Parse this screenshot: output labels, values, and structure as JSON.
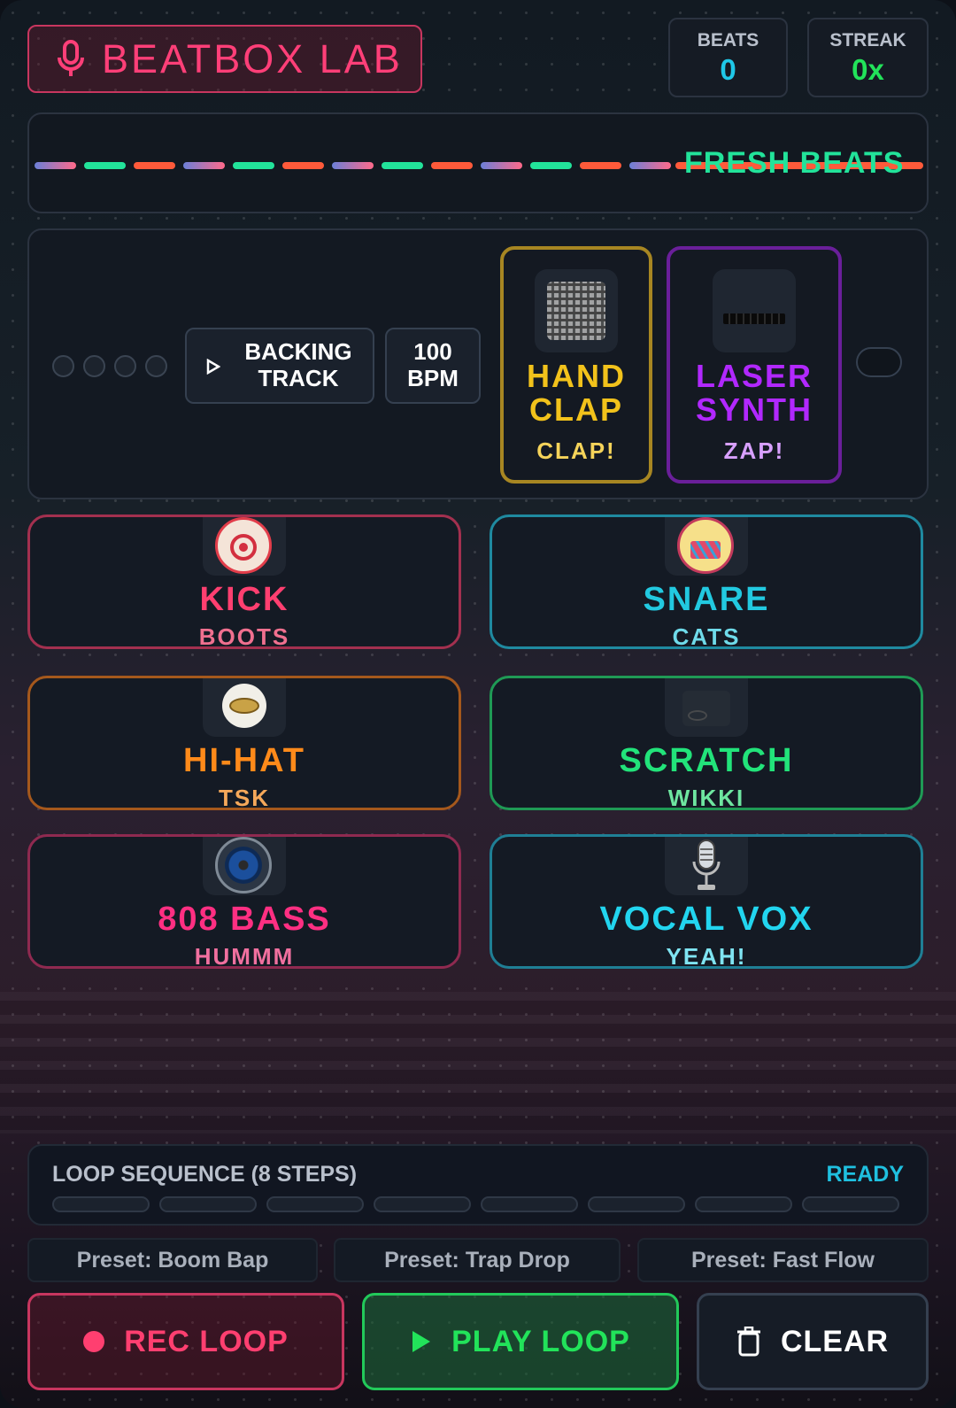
{
  "header": {
    "title": "BEATBOX LAB",
    "stats": [
      {
        "label": "BEATS",
        "value": "0",
        "color": "#1fc8e8"
      },
      {
        "label": "STREAK",
        "value": "0x",
        "color": "#22e35a"
      }
    ]
  },
  "banner": {
    "text": "FRESH BEATS"
  },
  "controls": {
    "backing_track": "BACKING TRACK",
    "bpm": "100 BPM"
  },
  "samples": [
    {
      "name": "HAND CLAP",
      "sound": "CLAP!",
      "color": "#f2c21b",
      "border": "#a78622",
      "icon": "launchpad-icon"
    },
    {
      "name": "LASER SYNTH",
      "sound": "ZAP!",
      "color": "#b128ff",
      "border": "#6a1f9a",
      "sound_color": "#d8a0ff",
      "icon": "synth-keyboard-icon"
    }
  ],
  "pads": [
    {
      "name": "KICK",
      "sound": "BOOTS",
      "color": "#ff3f70",
      "border": "#a3304f",
      "icon": "kick-drum-icon"
    },
    {
      "name": "SNARE",
      "sound": "CATS",
      "color": "#22c9e0",
      "border": "#1f8aa0",
      "icon": "snare-drum-icon"
    },
    {
      "name": "HI-HAT",
      "sound": "TSK",
      "color": "#ff8a1a",
      "border": "#a5581c",
      "icon": "hi-hat-icon"
    },
    {
      "name": "SCRATCH",
      "sound": "WIKKI",
      "color": "#22e37a",
      "border": "#1f9a55",
      "icon": "turntable-icon"
    },
    {
      "name": "808 BASS",
      "sound": "HUMMM",
      "color": "#ff2f82",
      "border": "#8f2a50",
      "icon": "speaker-icon"
    },
    {
      "name": "VOCAL VOX",
      "sound": "YEAH!",
      "color": "#22d5ef",
      "border": "#1f7f95",
      "icon": "microphone-icon"
    }
  ],
  "loop": {
    "title": "LOOP SEQUENCE (8 STEPS)",
    "status": "READY",
    "steps": 8
  },
  "presets": [
    "Preset: Boom Bap",
    "Preset: Trap Drop",
    "Preset: Fast Flow"
  ],
  "actions": {
    "rec": "REC LOOP",
    "play": "PLAY LOOP",
    "clear": "CLEAR"
  }
}
